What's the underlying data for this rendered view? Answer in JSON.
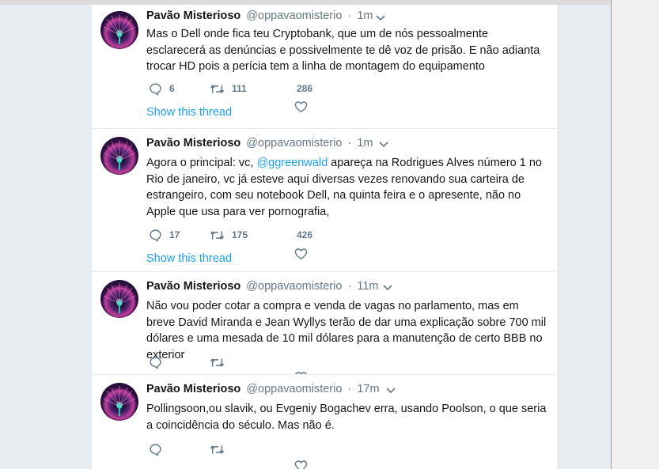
{
  "tweets": [
    {
      "name": "Pavão Misterioso",
      "handle": "@oppavaomisterio",
      "sep": "·",
      "time": "1m",
      "text": "Mas o Dell onde fica teu Cryptobank, que um de nós pessoalmente esclarecerá as denúncias e possivelmente te dê voz de prisão. E não adianta trocar HD pois a perícia tem a linha de montagem do equipamento",
      "replies": "6",
      "retweets": "111",
      "likes": "286",
      "show_thread": "Show this thread"
    },
    {
      "name": "Pavão Misterioso",
      "handle": "@oppavaomisterio",
      "sep": "·",
      "time": "1m",
      "text_before": "Agora o principal: vc, ",
      "mention": "@ggreenwald",
      "text_after": " apareça na Rodrigues Alves número 1 no Rio de janeiro, vc já esteve aqui diversas vezes renovando sua carteira de estrangeiro, com seu notebook Dell, na quinta feira e o apresente, não no Apple que usa para ver pornografia,",
      "replies": "17",
      "retweets": "175",
      "likes": "426",
      "show_thread": "Show this thread"
    },
    {
      "name": "Pavão Misterioso",
      "handle": "@oppavaomisterio",
      "sep": "·",
      "time": "11m",
      "text": "Não vou poder cotar a compra e venda de vagas no parlamento, mas em breve David Miranda e Jean Wyllys terão de dar uma explicação sobre 700 mil dólares e uma mesada de 10 mil dólares para a manutenção de certo BBB no exterior"
    },
    {
      "name": "Pavão Misterioso",
      "handle": "@oppavaomisterio",
      "sep": "·",
      "time": "17m",
      "text": "Pollingsoon,ou slavik, ou Evgeniy Bogachev erra, usando Poolson, o que seria a coincidência do século. Mas não é."
    }
  ],
  "icons": {
    "reply": "reply-icon",
    "retweet": "retweet-icon",
    "like": "heart-icon",
    "more": "chevron-down-icon",
    "avatar": "peacock-avatar"
  },
  "colors": {
    "link": "#1da1f2",
    "muted": "#657786",
    "text": "#14171a",
    "background": "#e6ecf0"
  }
}
